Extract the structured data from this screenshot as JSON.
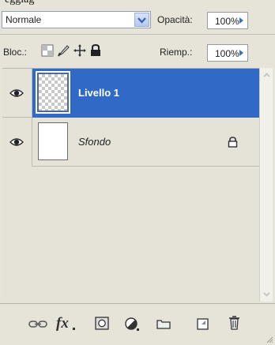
{
  "top_strip_text": "eggiag",
  "blend_mode": {
    "value": "Normale",
    "icon": "chevron-down-icon"
  },
  "opacity": {
    "label": "Opacità:",
    "value": "100%"
  },
  "lock": {
    "label": "Bloc.:",
    "icons": [
      "lock-transparent-icon",
      "lock-image-icon",
      "lock-position-icon",
      "lock-all-icon"
    ]
  },
  "fill": {
    "label": "Riemp.:",
    "value": "100%"
  },
  "layers": [
    {
      "name": "Livello 1",
      "selected": true,
      "visible": true,
      "thumbnail": "transparent"
    },
    {
      "name": "Sfondo",
      "selected": false,
      "visible": true,
      "thumbnail": "white",
      "locked": true
    }
  ],
  "bottom_toolbar": {
    "buttons": [
      "link-layers-icon",
      "layer-style-icon",
      "layer-mask-icon",
      "adjustment-layer-icon",
      "new-group-icon",
      "new-layer-icon",
      "delete-layer-icon"
    ],
    "fx_label": "fx"
  },
  "colors": {
    "selection": "#3169c6",
    "panel": "#e6e3d8"
  }
}
